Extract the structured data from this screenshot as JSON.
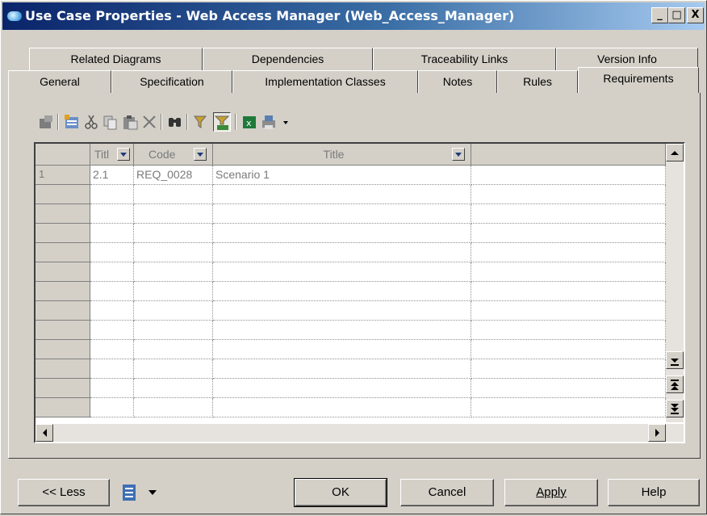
{
  "window": {
    "title": "Use Case Properties - Web Access Manager (Web_Access_Manager)"
  },
  "titlebar_buttons": {
    "minimize": "_",
    "maximize": "□",
    "close": "X"
  },
  "tabs": {
    "row1": [
      {
        "label": "Related Diagrams"
      },
      {
        "label": "Dependencies"
      },
      {
        "label": "Traceability Links"
      },
      {
        "label": "Version Info"
      }
    ],
    "row2": [
      {
        "label": "General"
      },
      {
        "label": "Specification"
      },
      {
        "label": "Implementation Classes"
      },
      {
        "label": "Notes"
      },
      {
        "label": "Rules"
      },
      {
        "label": "Requirements"
      }
    ],
    "active": "Requirements"
  },
  "toolbar": {
    "icons": [
      "properties-icon",
      "add-objects-icon",
      "cut-icon",
      "copy-icon",
      "paste-icon",
      "delete-icon",
      "find-icon",
      "filter-icon",
      "customize-columns-icon",
      "excel-export-icon",
      "print-icon",
      "dropdown-icon"
    ]
  },
  "grid": {
    "columns": [
      {
        "label": "Titl"
      },
      {
        "label": "Code"
      },
      {
        "label": "Title"
      }
    ],
    "rows": [
      {
        "num": "1",
        "titl": "2.1",
        "code": "REQ_0028",
        "title": "Scenario 1"
      }
    ]
  },
  "buttons": {
    "less": "<< Less",
    "ok": "OK",
    "cancel": "Cancel",
    "apply": "Apply",
    "help": "Help"
  }
}
